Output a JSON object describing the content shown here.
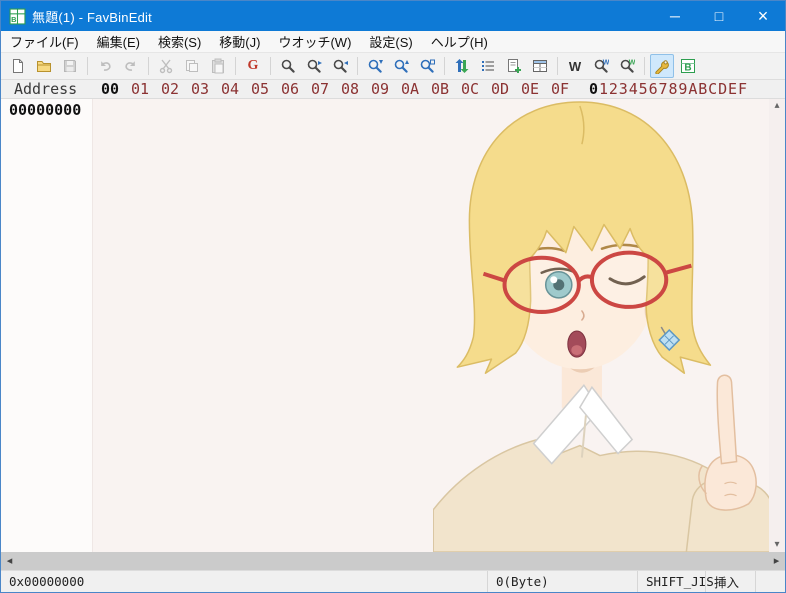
{
  "window": {
    "title": "無題(1) - FavBinEdit",
    "minimize_glyph": "─",
    "maximize_glyph": "□",
    "close_glyph": "×"
  },
  "menu": {
    "items": [
      {
        "label": "ファイル(F)"
      },
      {
        "label": "編集(E)"
      },
      {
        "label": "検索(S)"
      },
      {
        "label": "移動(J)"
      },
      {
        "label": "ウオッチ(W)"
      },
      {
        "label": "設定(S)"
      },
      {
        "label": "ヘルプ(H)"
      }
    ]
  },
  "toolbar": {
    "buttons": [
      {
        "name": "new-file"
      },
      {
        "name": "open-file"
      },
      {
        "name": "save-file",
        "disabled": true
      },
      {
        "name": "undo",
        "disabled": true
      },
      {
        "name": "redo",
        "disabled": true
      },
      {
        "name": "cut",
        "disabled": true
      },
      {
        "name": "copy",
        "disabled": true
      },
      {
        "name": "paste",
        "disabled": true
      },
      {
        "name": "jump-address",
        "glyph": "G",
        "color": "#c0392b"
      },
      {
        "name": "find"
      },
      {
        "name": "find-next"
      },
      {
        "name": "find-prev"
      },
      {
        "name": "search-down"
      },
      {
        "name": "search-up"
      },
      {
        "name": "search-select"
      },
      {
        "name": "swap-bytes"
      },
      {
        "name": "watch-list"
      },
      {
        "name": "add-watch"
      },
      {
        "name": "watch-window"
      },
      {
        "name": "watch",
        "glyph": "W",
        "color": "#333333"
      },
      {
        "name": "watch-find"
      },
      {
        "name": "watch-find-next"
      },
      {
        "name": "settings-wrench",
        "active": true
      },
      {
        "name": "binary-mode",
        "glyph": "B",
        "color": "#1e8e3e"
      }
    ]
  },
  "hex_header": {
    "address_label": "Address",
    "columns": [
      "00",
      "01",
      "02",
      "03",
      "04",
      "05",
      "06",
      "07",
      "08",
      "09",
      "0A",
      "0B",
      "0C",
      "0D",
      "0E",
      "0F"
    ],
    "ascii_active": "0",
    "ascii_rest": "123456789ABCDEF"
  },
  "hex_body": {
    "first_address": "00000000"
  },
  "statusbar": {
    "position": "0x00000000",
    "size": "0(Byte)",
    "encoding": "SHIFT_JIS",
    "insert_mode": "挿入"
  },
  "colors": {
    "titlebar": "#0e7ad6",
    "header_text": "#8b3232",
    "header_active_text": "#111111",
    "active_button_bg": "#cfe8fc",
    "content_bg": "#f9f3f1"
  }
}
